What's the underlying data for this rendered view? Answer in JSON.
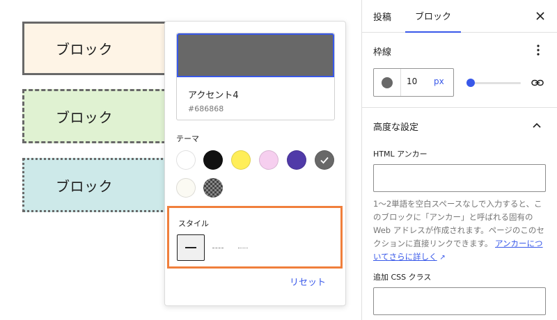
{
  "canvas": {
    "blocks": [
      {
        "label": "ブロック",
        "background": "#fef4e6",
        "border_style": "solid"
      },
      {
        "label": "ブロック",
        "background": "#e0f2d2",
        "border_style": "dashed"
      },
      {
        "label": "ブロック",
        "background": "#cde9e9",
        "border_style": "dotted"
      }
    ]
  },
  "color_popover": {
    "selected_color": {
      "name": "アクセント4",
      "hex": "#686868"
    },
    "theme_label": "テーマ",
    "palette": [
      {
        "color": "#ffffff",
        "selected": false
      },
      {
        "color": "#111111",
        "selected": false
      },
      {
        "color": "#ffee58",
        "selected": false
      },
      {
        "color": "#f6cfef",
        "selected": false
      },
      {
        "color": "#503aa8",
        "selected": false
      },
      {
        "color": "#686868",
        "selected": true
      },
      {
        "color": "#fbfaf3",
        "selected": false
      },
      {
        "color": "transparent-checker",
        "selected": false
      }
    ],
    "style_label": "スタイル",
    "styles": [
      "solid",
      "dashed",
      "dotted"
    ],
    "active_style": "solid",
    "reset_label": "リセット",
    "highlight_color": "#f07f3c"
  },
  "sidebar": {
    "tabs": [
      {
        "label": "投稿"
      },
      {
        "label": "ブロック"
      }
    ],
    "active_tab": "ブロック",
    "border": {
      "title": "枠線",
      "width_value": "10",
      "unit": "px",
      "color": "#686868"
    },
    "advanced": {
      "title": "高度な設定",
      "anchor_label": "HTML アンカー",
      "anchor_value": "",
      "help_text": "1〜2単語を空白スペースなしで入力すると、このブロックに「アンカー」と呼ばれる固有の Web アドレスが作成されます。ページのこのセクションに直接リンクできます。",
      "help_link": "アンカーについてさらに詳しく",
      "css_class_label": "追加 CSS クラス",
      "css_class_value": ""
    }
  },
  "colors": {
    "accent": "#3858e9"
  }
}
